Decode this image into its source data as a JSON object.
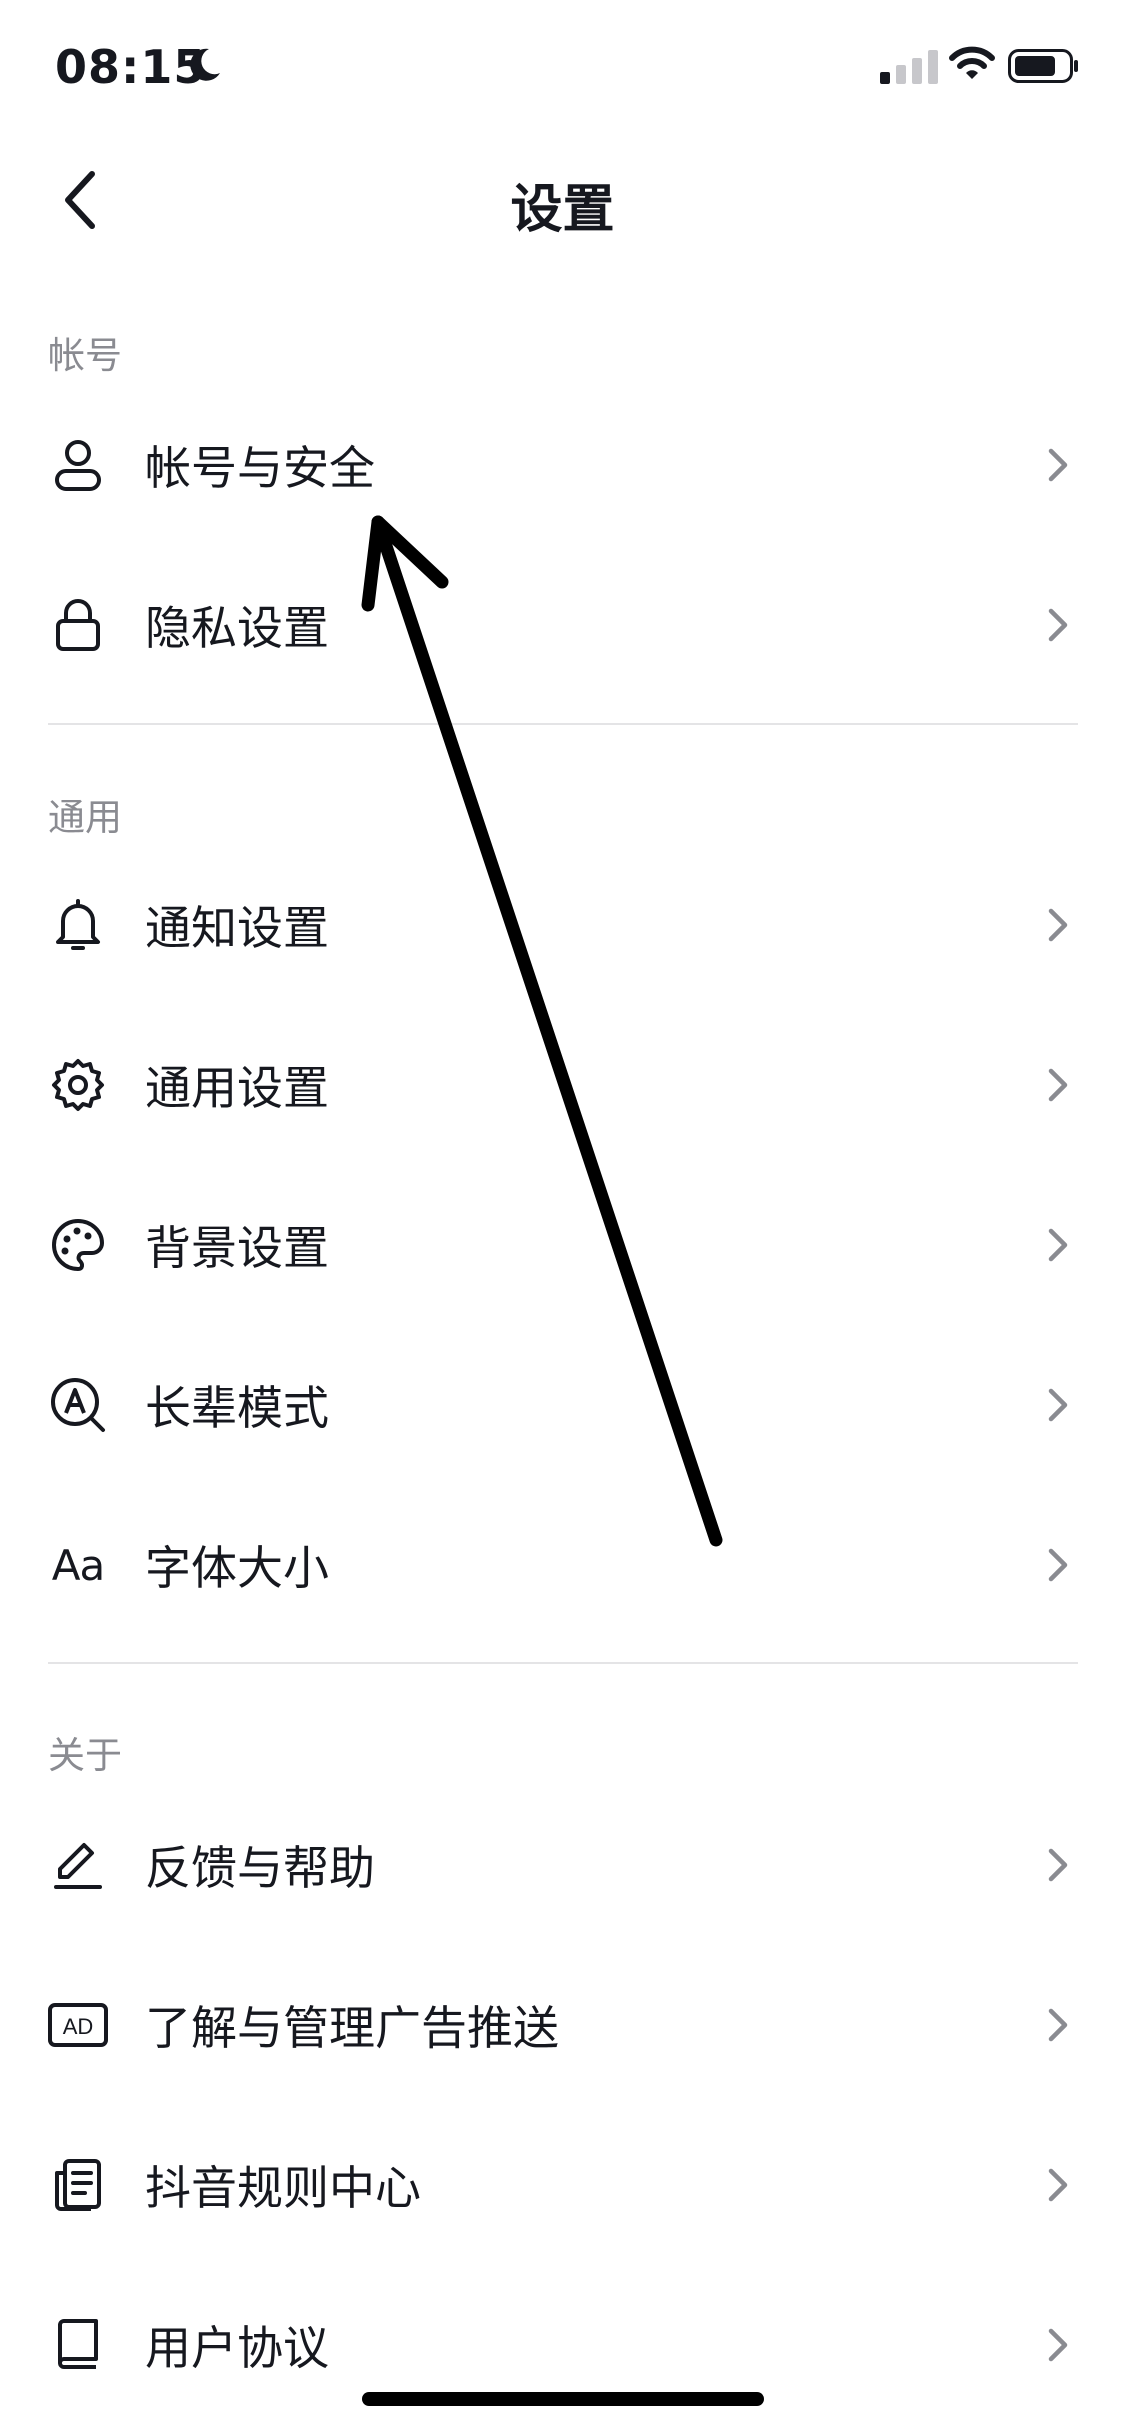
{
  "status_bar": {
    "time": "08:15",
    "moon_icon": "moon-icon",
    "signal_icon": "cellular-signal-icon",
    "wifi_icon": "wifi-icon",
    "battery_icon": "battery-icon"
  },
  "nav": {
    "title": "设置",
    "back_icon": "chevron-left-icon"
  },
  "sections": [
    {
      "header": "帐号",
      "items": [
        {
          "label": "帐号与安全",
          "icon": "user-icon"
        },
        {
          "label": "隐私设置",
          "icon": "lock-icon"
        }
      ]
    },
    {
      "header": "通用",
      "items": [
        {
          "label": "通知设置",
          "icon": "bell-icon"
        },
        {
          "label": "通用设置",
          "icon": "gear-icon"
        },
        {
          "label": "背景设置",
          "icon": "palette-icon"
        },
        {
          "label": "长辈模式",
          "icon": "elder-mode-icon"
        },
        {
          "label": "字体大小",
          "icon": "font-size-icon",
          "icon_text": "Aa"
        }
      ]
    },
    {
      "header": "关于",
      "items": [
        {
          "label": "反馈与帮助",
          "icon": "edit-pencil-icon"
        },
        {
          "label": "了解与管理广告推送",
          "icon": "ad-icon",
          "icon_text": "AD"
        },
        {
          "label": "抖音规则中心",
          "icon": "document-list-icon"
        },
        {
          "label": "用户协议",
          "icon": "book-icon"
        }
      ]
    }
  ],
  "chevron_icon": "chevron-right-icon",
  "colors": {
    "text": "#16181f",
    "section_header": "#8a8b91",
    "chevron": "#8a8b91",
    "divider": "#e4e4e6",
    "annotation_arrow": "#000000"
  }
}
